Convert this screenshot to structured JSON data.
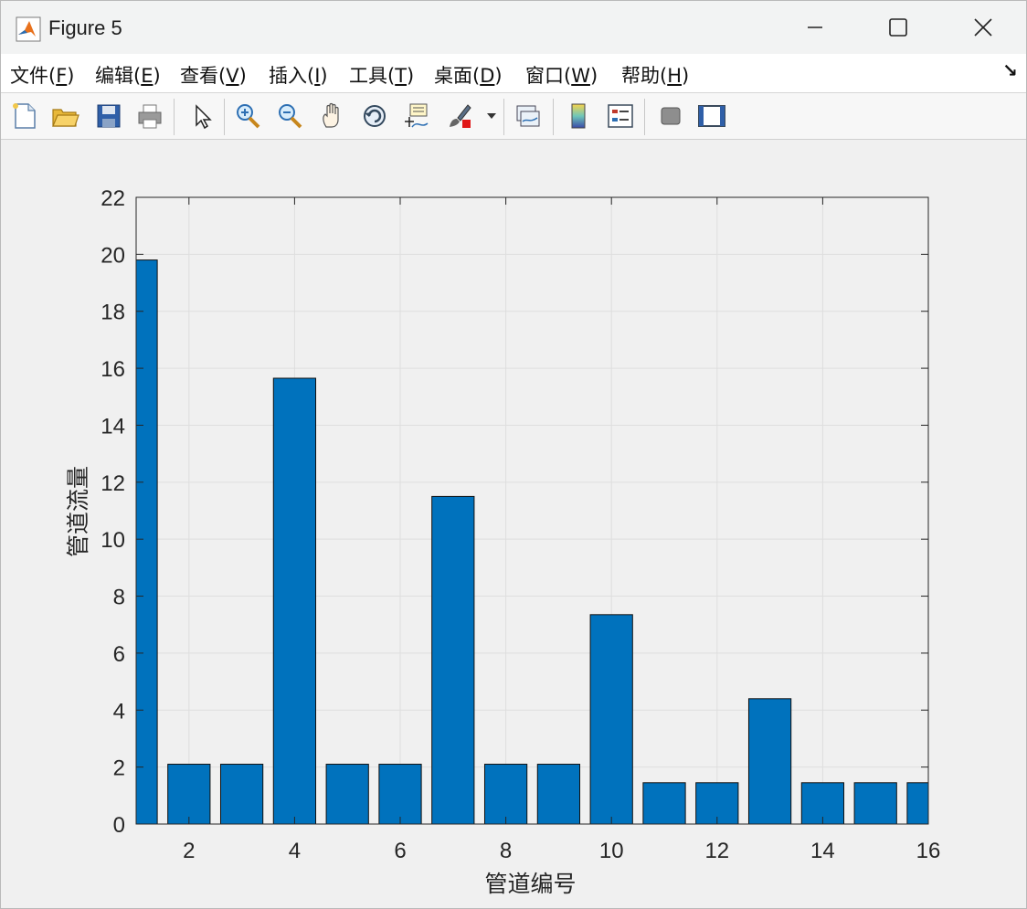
{
  "window": {
    "title": "Figure 5",
    "minimize_label": "minimize",
    "maximize_label": "maximize",
    "close_label": "close"
  },
  "menu": {
    "items": [
      {
        "text": "文件(",
        "key": "F",
        "end": ")"
      },
      {
        "text": "编辑(",
        "key": "E",
        "end": ")"
      },
      {
        "text": "查看(",
        "key": "V",
        "end": ")"
      },
      {
        "text": "插入(",
        "key": "I",
        "end": ")"
      },
      {
        "text": "工具(",
        "key": "T",
        "end": ")"
      },
      {
        "text": "桌面(",
        "key": "D",
        "end": ")"
      },
      {
        "text": "窗口(",
        "key": "W",
        "end": ")"
      },
      {
        "text": "帮助(",
        "key": "H",
        "end": ")"
      }
    ],
    "dock_arrow": "↘"
  },
  "toolbar": {
    "icons": [
      "new-file-icon",
      "open-folder-icon",
      "save-icon",
      "print-icon",
      "pointer-icon",
      "zoom-in-icon",
      "zoom-out-icon",
      "pan-hand-icon",
      "rotate-3d-icon",
      "data-cursor-icon",
      "brush-icon",
      "brush-dropdown-icon",
      "link-plot-icon",
      "colorbar-icon",
      "legend-icon",
      "hide-plot-tools-icon",
      "show-plot-tools-icon"
    ]
  },
  "colors": {
    "bar": "#0072BD",
    "grid": "#dedede",
    "axis": "#262626"
  },
  "chart_data": {
    "type": "bar",
    "x": [
      1,
      2,
      3,
      4,
      5,
      6,
      7,
      8,
      9,
      10,
      11,
      12,
      13,
      14,
      15,
      16
    ],
    "values": [
      19.8,
      2.1,
      2.1,
      15.65,
      2.1,
      2.1,
      11.5,
      2.1,
      2.1,
      7.35,
      1.45,
      1.45,
      4.4,
      1.45,
      1.45,
      1.45
    ],
    "xlim": [
      1,
      16
    ],
    "ylim": [
      0,
      22
    ],
    "xticks": [
      2,
      4,
      6,
      8,
      10,
      12,
      14,
      16
    ],
    "yticks": [
      0,
      2,
      4,
      6,
      8,
      10,
      12,
      14,
      16,
      18,
      20,
      22
    ],
    "xlabel": "管道编号",
    "ylabel": "管道流量",
    "grid": true
  }
}
